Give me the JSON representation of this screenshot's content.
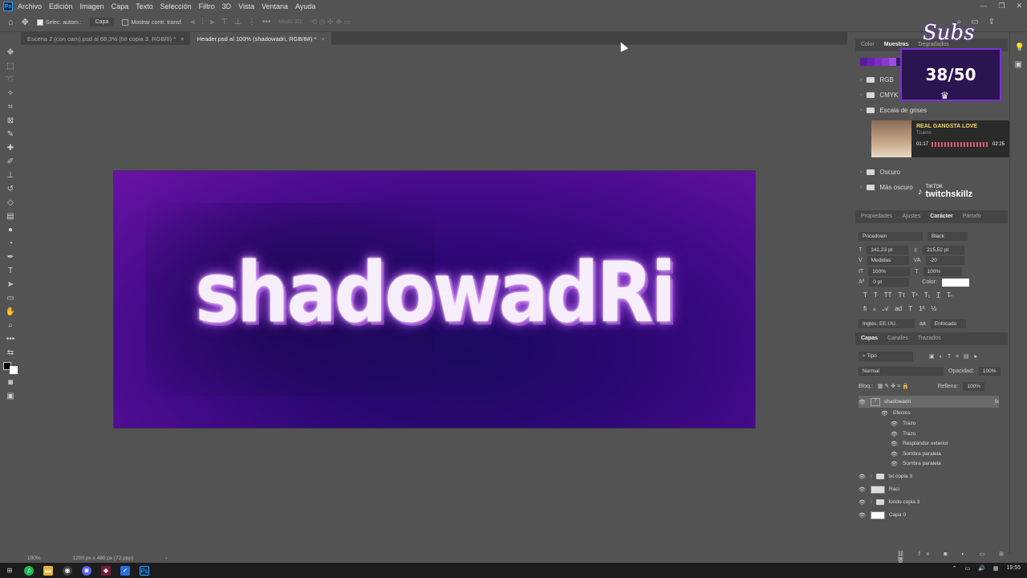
{
  "menubar": {
    "logo": "Ps",
    "items": [
      "Archivo",
      "Edición",
      "Imagen",
      "Capa",
      "Texto",
      "Selección",
      "Filtro",
      "3D",
      "Vista",
      "Ventana",
      "Ayuda"
    ]
  },
  "options": {
    "auto_select_label": "Selec. autom.:",
    "layer_select": "Capa",
    "show_transform_label": "Mostrar contr. transf.",
    "mode_3d": "Modo 3D:"
  },
  "tabs": [
    {
      "label": "Escena 2 (con cam).psd al 68,3% (txt copia 3, RGB/8) *"
    },
    {
      "label": "Header.psd al 100% (shadowadri, RGB/8#) *"
    }
  ],
  "canvas": {
    "headline": "shadowadRi"
  },
  "status": {
    "zoom": "100%",
    "doc_size": "1200 px x 480 px (72 ppp)"
  },
  "swatches": {
    "tabs": [
      "Color",
      "Muestras",
      "Degradados"
    ],
    "colors": [
      "#5a1a9c",
      "#6d22b3",
      "#7f2cc7",
      "#8a3ad0",
      "#9c4fdc",
      "#3a1670",
      "#22133f",
      "#111111",
      "#2c2c2c",
      "#5b5b5b",
      "#888888"
    ],
    "folders": [
      "RGB",
      "CMYK",
      "Escala de grises",
      "Oscuro",
      "Más oscuro"
    ]
  },
  "overlays": {
    "subs_title": "Subs",
    "subs_count": "38/50",
    "song": "REAL GANGSTA LOVE",
    "artist": "Trueno",
    "time_current": "01:17",
    "time_total": "02:25",
    "tiktok_label": "TIKTOK",
    "tiktok_user": "twitchskillz"
  },
  "character": {
    "tabs": [
      "Propiedades",
      "Ajustes",
      "Carácter",
      "Párrafo"
    ],
    "font": "Pricedown",
    "style": "Black",
    "size": "141,23 pt",
    "leading": "215,52 pt",
    "kerning": "Medidas",
    "tracking": "-20",
    "vscale": "100%",
    "hscale": "100%",
    "baseline": "0 pt",
    "color_label": "Color:",
    "language": "Inglés: EE.UU.",
    "antialias": "Enfocado"
  },
  "layers": {
    "tabs": [
      "Capas",
      "Canales",
      "Trazados"
    ],
    "filter": "Tipo",
    "blend": "Normal",
    "opacity_label": "Opacidad:",
    "opacity": "100%",
    "lock_label": "Bloq.:",
    "fill_label": "Relleno:",
    "fill": "100%",
    "items": [
      {
        "name": "shadowadri"
      },
      {
        "name": "Efectos"
      },
      {
        "name": "Trazo"
      },
      {
        "name": "Trazo"
      },
      {
        "name": "Resplandor exterior"
      },
      {
        "name": "Sombra paralela"
      },
      {
        "name": "Sombra paralela"
      },
      {
        "name": "txt copia 3"
      },
      {
        "name": "Raci"
      },
      {
        "name": "fondo copia 3"
      },
      {
        "name": "Capa 0"
      }
    ]
  },
  "taskbar": {
    "time": "19:55"
  }
}
